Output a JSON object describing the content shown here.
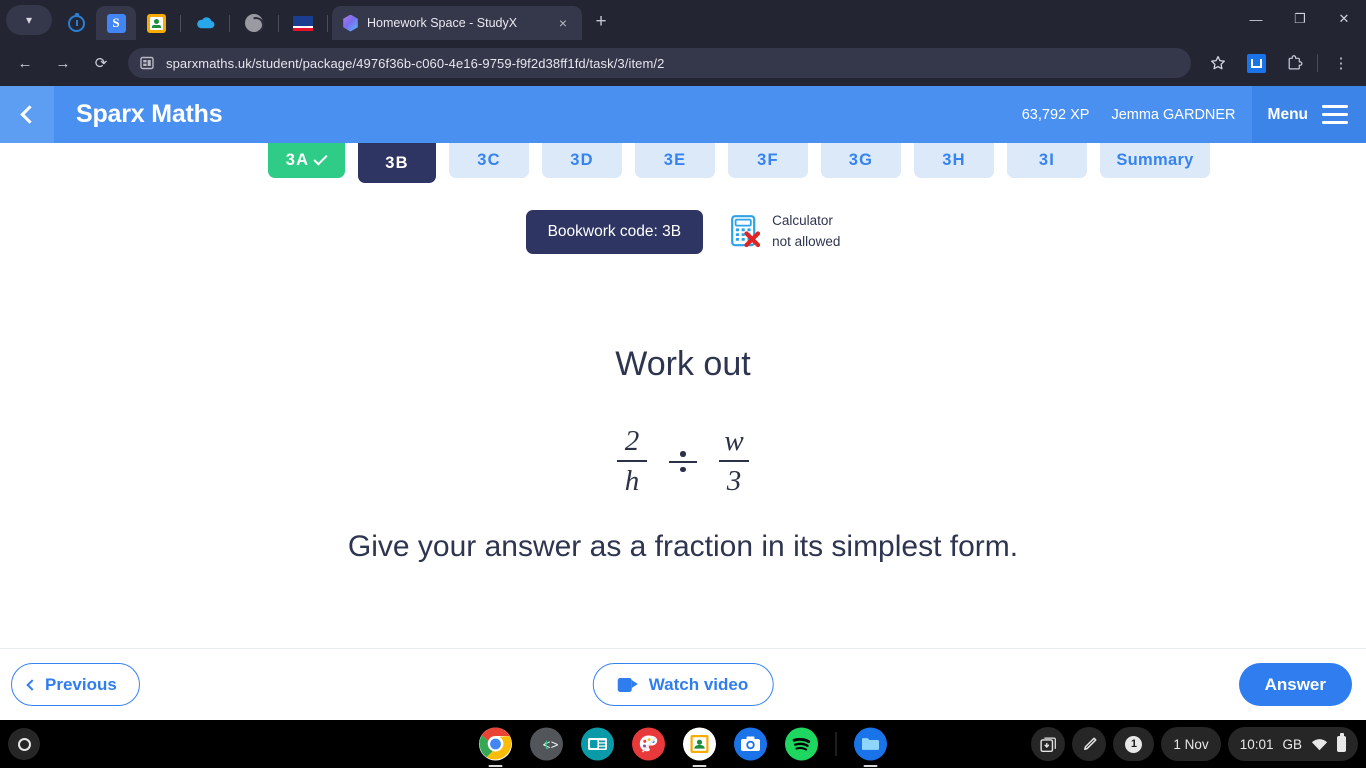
{
  "browser": {
    "window_controls": {
      "minimize": "minimize-icon",
      "restore": "restore-icon",
      "close": "close-icon"
    },
    "tab_list_chevron": "chevron-down-icon",
    "pinned_tabs": [
      {
        "name": "timer-tab",
        "icon": "timer-icon"
      },
      {
        "name": "sparx-tab",
        "icon": "sparx-s-icon",
        "letter": "S",
        "active_pin": true
      },
      {
        "name": "classroom-tab",
        "icon": "google-classroom-icon"
      },
      {
        "name": "onedrive-tab",
        "icon": "cloud-icon"
      },
      {
        "name": "globe-tab",
        "icon": "globe-icon"
      },
      {
        "name": "flag-tab",
        "icon": "flag-icon"
      }
    ],
    "active_tab": {
      "title": "Homework Space - StudyX",
      "favicon": "studyx-cube-icon",
      "close": "×"
    },
    "new_tab_label": "+",
    "nav": {
      "back": "←",
      "forward": "→",
      "reload": "⟳"
    },
    "omnibox": {
      "site_icon": "page-info-icon",
      "url": "sparxmaths.uk/student/package/4976f36b-c060-4e16-9759-f9f2d38ff1fd/task/3/item/2"
    },
    "toolbar_right": {
      "bookmark": "star-icon",
      "extension_pinned": "blue-extension-icon",
      "extensions": "puzzle-icon",
      "menu": "three-dot-menu-icon"
    }
  },
  "app": {
    "back_button": "back-chevron",
    "brand": "Sparx Maths",
    "xp": "63,792 XP",
    "user": "Jemma GARDNER",
    "menu_label": "Menu",
    "menu_icon": "hamburger-icon",
    "colors": {
      "header": "#4a90f0",
      "accent": "#2f7def",
      "navy": "#2e3562",
      "green": "#2ecc87"
    }
  },
  "tabs": [
    {
      "label": "3A",
      "state": "done"
    },
    {
      "label": "3B",
      "state": "current"
    },
    {
      "label": "3C",
      "state": "todo"
    },
    {
      "label": "3D",
      "state": "todo"
    },
    {
      "label": "3E",
      "state": "todo"
    },
    {
      "label": "3F",
      "state": "todo"
    },
    {
      "label": "3G",
      "state": "todo"
    },
    {
      "label": "3H",
      "state": "todo"
    },
    {
      "label": "3I",
      "state": "todo"
    },
    {
      "label": "Summary",
      "state": "summary"
    }
  ],
  "meta": {
    "bookwork_code": "Bookwork code: 3B",
    "calculator_icon": "calculator-not-allowed-icon",
    "calculator_line1": "Calculator",
    "calculator_line2": "not allowed"
  },
  "question": {
    "prompt": "Work out",
    "expression": {
      "left": {
        "numerator": "2",
        "denominator": "h"
      },
      "operator": "÷",
      "right": {
        "numerator": "w",
        "denominator": "3"
      }
    },
    "instruction": "Give your answer as a fraction in its simplest form."
  },
  "footer": {
    "previous": "Previous",
    "watch_video": "Watch video",
    "video_icon": "video-camera-icon",
    "answer": "Answer"
  },
  "shelf": {
    "launcher": "launcher-icon",
    "apps": [
      {
        "name": "chrome",
        "running": true
      },
      {
        "name": "tynker",
        "label": "<t>",
        "running": false
      },
      {
        "name": "news",
        "running": false
      },
      {
        "name": "paint-palette",
        "running": false
      },
      {
        "name": "google-classroom",
        "running": true
      },
      {
        "name": "camera",
        "running": false
      },
      {
        "name": "spotify",
        "running": false
      },
      {
        "name": "files",
        "running": true
      }
    ],
    "tray": {
      "downloads_icon": "download-tray-icon",
      "stylus_icon": "stylus-pen-icon",
      "notification_count": "1",
      "date": "1 Nov",
      "time": "10:01",
      "locale": "GB",
      "wifi_icon": "wifi-icon",
      "battery_icon": "battery-icon"
    }
  }
}
